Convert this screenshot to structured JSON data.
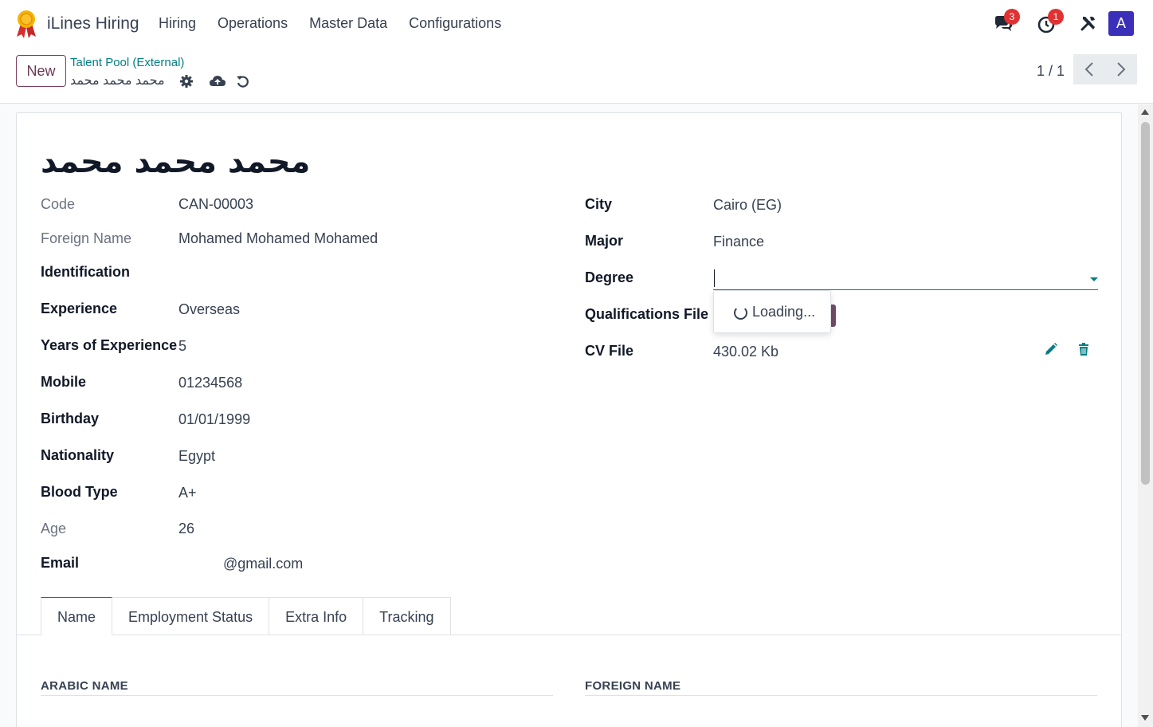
{
  "navbar": {
    "app_name": "iLines Hiring",
    "menu": [
      "Hiring",
      "Operations",
      "Master Data",
      "Configurations"
    ],
    "messages_badge": "3",
    "activities_badge": "1",
    "avatar_letter": "A"
  },
  "control_panel": {
    "new_label": "New",
    "breadcrumb_parent": "Talent Pool (External)",
    "breadcrumb_current": "محمد محمد محمد",
    "pager": "1 / 1"
  },
  "form": {
    "title": "محمد محمد محمد",
    "left": {
      "code_label": "Code",
      "code_value": "CAN-00003",
      "foreign_name_label": "Foreign Name",
      "foreign_name_value": "Mohamed Mohamed Mohamed",
      "identification_label": "Identification",
      "experience_label": "Experience",
      "experience_value": "Overseas",
      "years_label": "Years of Experience",
      "years_value": "5",
      "mobile_label": "Mobile",
      "mobile_value": "01234568",
      "birthday_label": "Birthday",
      "birthday_value": "01/01/1999",
      "nationality_label": "Nationality",
      "nationality_value": "Egypt",
      "blood_label": "Blood Type",
      "blood_value": "A+",
      "age_label": "Age",
      "age_value": "26",
      "email_label": "Email",
      "email_value": "@gmail.com"
    },
    "right": {
      "city_label": "City",
      "city_value": "Cairo (EG)",
      "major_label": "Major",
      "major_value": "Finance",
      "degree_label": "Degree",
      "qualifications_label": "Qualifications File",
      "cv_label": "CV File",
      "cv_value": "430.02 Kb",
      "loading_text": "Loading..."
    },
    "tabs": [
      "Name",
      "Employment Status",
      "Extra Info",
      "Tracking"
    ],
    "sections": {
      "arabic_name": "ARABIC NAME",
      "foreign_name": "FOREIGN NAME"
    }
  }
}
